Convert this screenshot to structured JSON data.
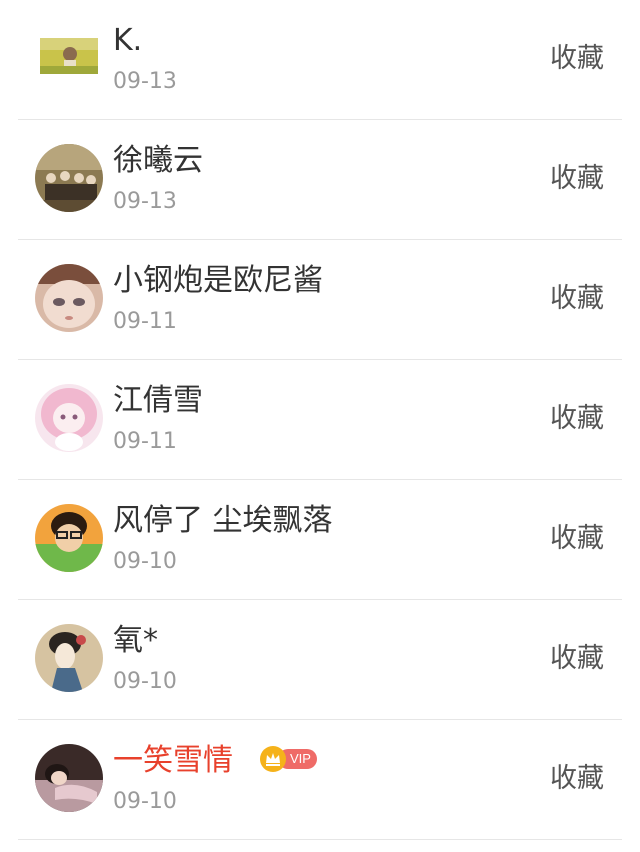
{
  "action_label": "收藏",
  "items": [
    {
      "name": "K.",
      "date": "09-13",
      "avatar": "landscape-photo-avatar"
    },
    {
      "name": "徐曦云",
      "date": "09-13",
      "avatar": "group-photo-avatar"
    },
    {
      "name": "小钢炮是欧尼酱",
      "date": "09-11",
      "avatar": "doll-face-avatar"
    },
    {
      "name": "江倩雪",
      "date": "09-11",
      "avatar": "anime-girl-avatar"
    },
    {
      "name": "风停了 尘埃飘落",
      "date": "09-10",
      "avatar": "boy-glasses-avatar"
    },
    {
      "name": "氧*",
      "date": "09-10",
      "avatar": "painted-lady-avatar"
    },
    {
      "name": "一笑雪情",
      "date": "09-10",
      "avatar": "reclining-person-avatar",
      "vip": true,
      "vip_label": "VIP"
    }
  ],
  "colors": {
    "vip_name": "#e8412c",
    "vip_badge": "#ef6b67",
    "divider": "#e6e6e6"
  }
}
